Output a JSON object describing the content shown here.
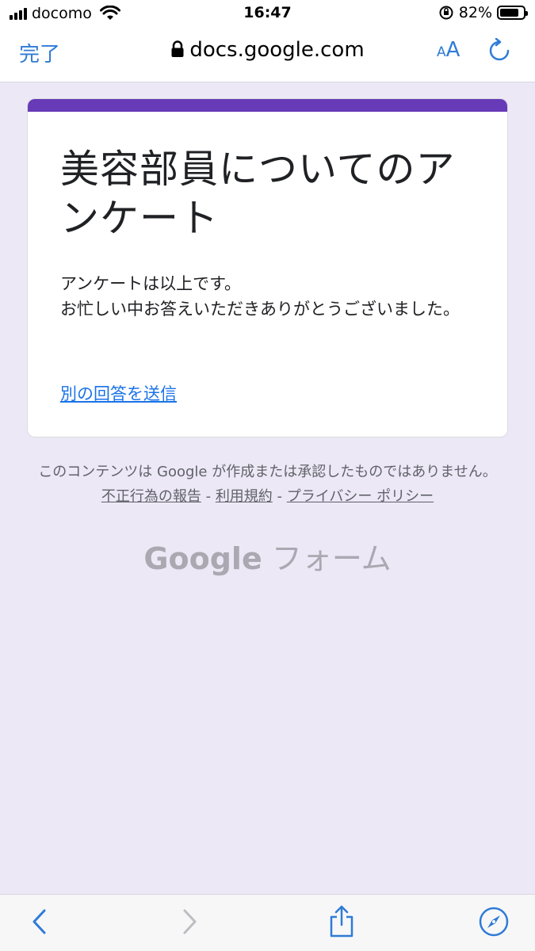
{
  "status_bar": {
    "carrier": "docomo",
    "time": "16:47",
    "battery_percent": "82%",
    "battery_level": 0.82
  },
  "browser": {
    "done_label": "完了",
    "url": "docs.google.com",
    "aa_small": "A",
    "aa_large": "A"
  },
  "form": {
    "accent_color": "#673ab7",
    "title": "美容部員についてのアンケート",
    "message_line1": "アンケートは以上です。",
    "message_line2": "お忙しい中お答えいただきありがとうございました。",
    "another_response": "別の回答を送信"
  },
  "footer": {
    "disclaimer": "このコンテンツは Google が作成または承認したものではありません。",
    "report_abuse": "不正行為の報告",
    "terms": "利用規約",
    "privacy": "プライバシー ポリシー",
    "separator": "-",
    "logo_google": "Google",
    "logo_forms": "フォーム"
  },
  "icons": {
    "back": "chevron-left-icon",
    "forward": "chevron-right-icon",
    "share": "share-icon",
    "bookmarks": "compass-icon"
  }
}
